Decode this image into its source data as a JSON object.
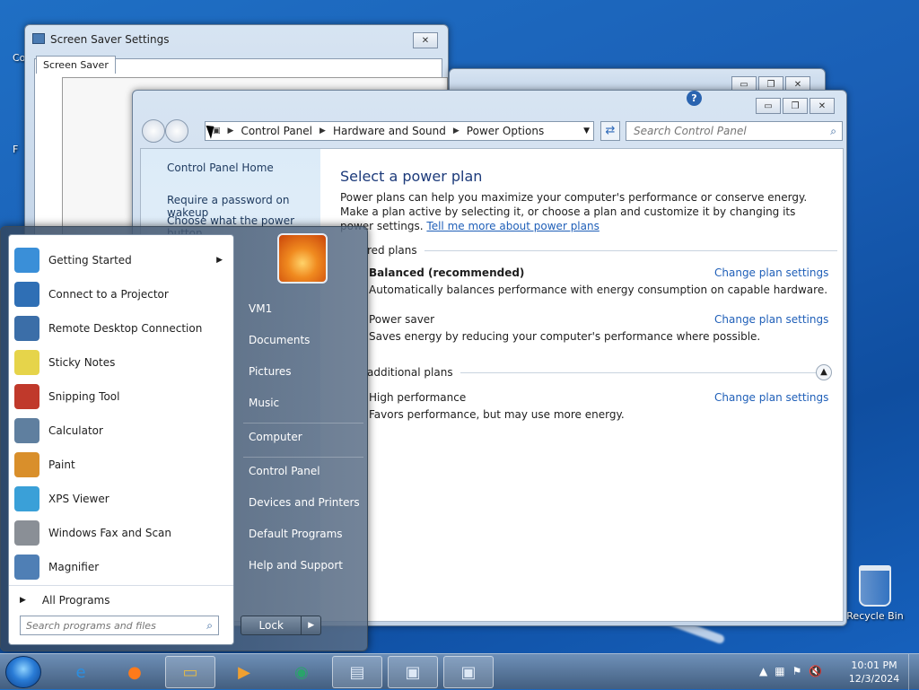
{
  "desktop": {
    "recycle_bin_label": "Recycle Bin",
    "left_icon_fragment_1": "Co",
    "left_icon_fragment_2": "F"
  },
  "screen_saver_window": {
    "title": "Screen Saver Settings",
    "tab": "Screen Saver",
    "close_icon": "close-icon"
  },
  "power_window": {
    "breadcrumb": [
      "Control Panel",
      "Hardware and Sound",
      "Power Options"
    ],
    "search_placeholder": "Search Control Panel",
    "left_nav": {
      "home": "Control Panel Home",
      "item1": "Require a password on wakeup",
      "item2": "Choose what the power button"
    },
    "heading": "Select a power plan",
    "description": "Power plans can help you maximize your computer's performance or conserve energy. Make a plan active by selecting it, or choose a plan and customize it by changing its power settings.",
    "tell_me_more": "Tell me more about power plans",
    "group_preferred": "red plans",
    "group_additional": "additional plans",
    "plans": [
      {
        "name": "Balanced (recommended)",
        "desc": "Automatically balances performance with energy consumption on capable hardware.",
        "link": "Change plan settings",
        "bold": true
      },
      {
        "name": "Power saver",
        "desc": "Saves energy by reducing your computer's performance where possible.",
        "link": "Change plan settings",
        "bold": false
      },
      {
        "name": "High performance",
        "desc": "Favors performance, but may use more energy.",
        "link": "Change plan settings",
        "bold": false
      }
    ]
  },
  "start_menu": {
    "programs": [
      {
        "label": "Getting Started",
        "icon": "getting-started-icon",
        "color": "#3a8fd8",
        "submenu": true
      },
      {
        "label": "Connect to a Projector",
        "icon": "projector-icon",
        "color": "#2f6fb5"
      },
      {
        "label": "Remote Desktop Connection",
        "icon": "remote-desktop-icon",
        "color": "#3b6ea8"
      },
      {
        "label": "Sticky Notes",
        "icon": "sticky-notes-icon",
        "color": "#e6d44a"
      },
      {
        "label": "Snipping Tool",
        "icon": "scissors-icon",
        "color": "#c0392b"
      },
      {
        "label": "Calculator",
        "icon": "calculator-icon",
        "color": "#5f7f9f"
      },
      {
        "label": "Paint",
        "icon": "paint-icon",
        "color": "#d98f2b"
      },
      {
        "label": "XPS Viewer",
        "icon": "xps-viewer-icon",
        "color": "#3aa0d8"
      },
      {
        "label": "Windows Fax and Scan",
        "icon": "fax-icon",
        "color": "#8a8f96"
      },
      {
        "label": "Magnifier",
        "icon": "magnifier-icon",
        "color": "#4f7fb5"
      }
    ],
    "all_programs": "All Programs",
    "search_placeholder": "Search programs and files",
    "right_links": [
      "VM1",
      "Documents",
      "Pictures",
      "Music",
      "Computer",
      "Control Panel",
      "Devices and Printers",
      "Default Programs",
      "Help and Support"
    ],
    "lock": "Lock"
  },
  "taskbar": {
    "clock_time": "10:01 PM",
    "clock_date": "12/3/2024"
  }
}
